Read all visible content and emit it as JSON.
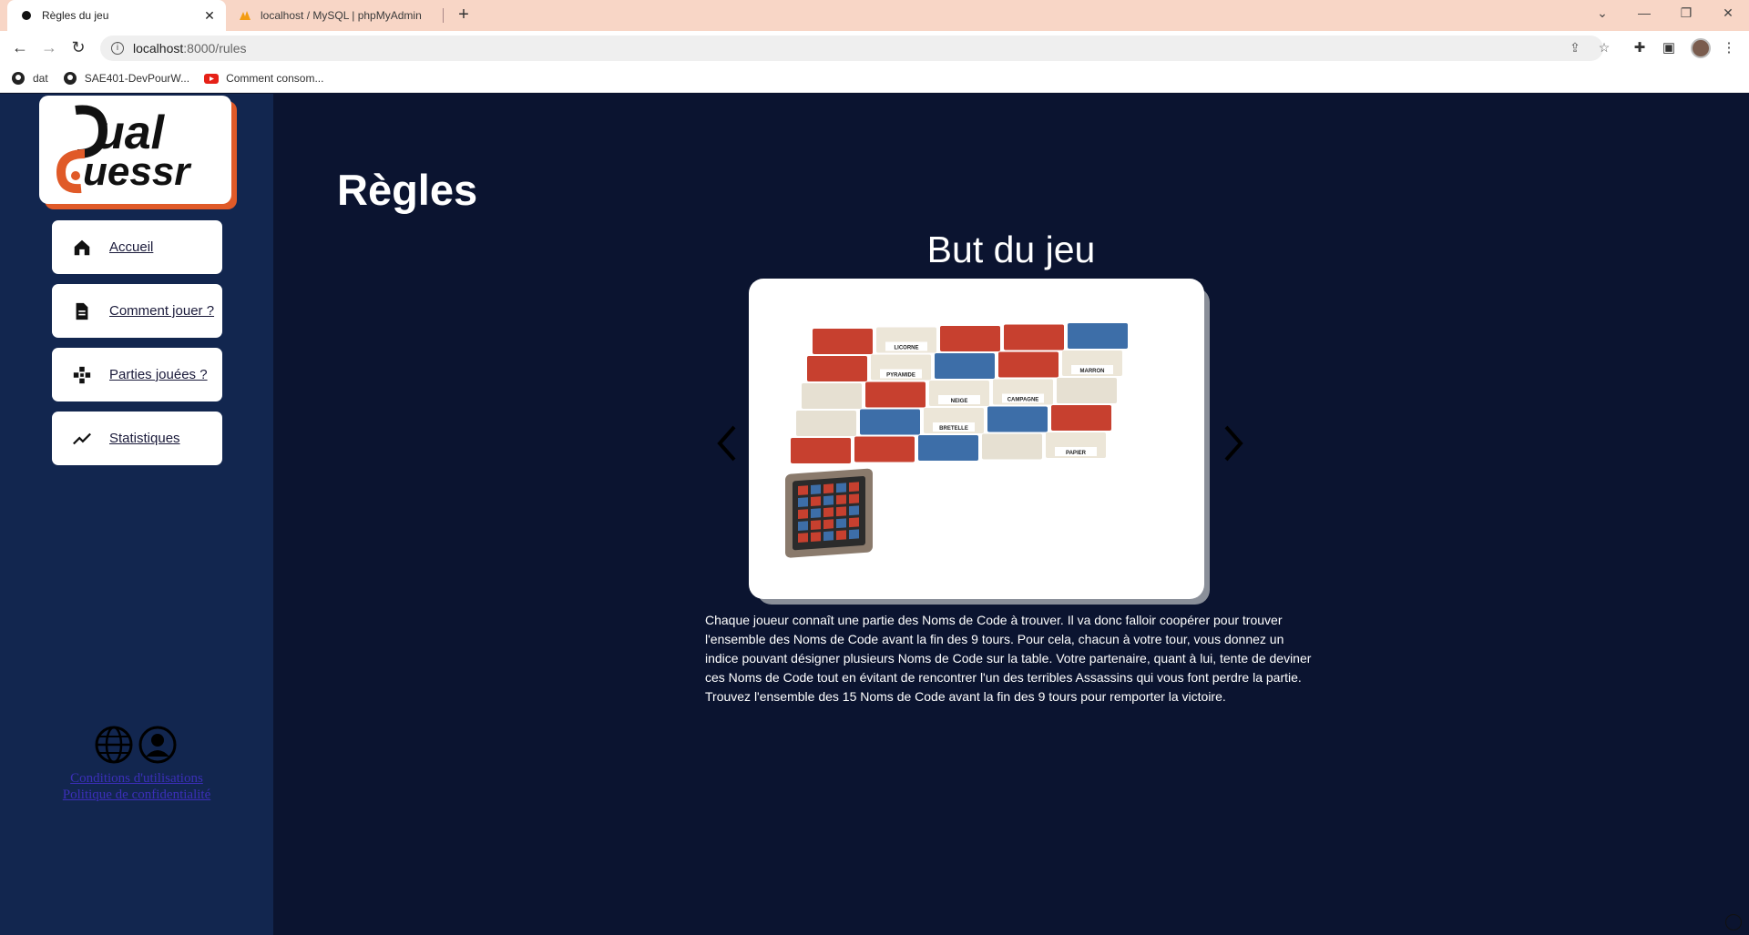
{
  "browser": {
    "tabs": [
      {
        "title": "Règles du jeu",
        "close": "✕"
      },
      {
        "title": "localhost / MySQL | phpMyAdmin"
      }
    ],
    "new_tab": "+",
    "url_host": "localhost",
    "url_path": ":8000/rules",
    "bookmarks": [
      {
        "label": "dat"
      },
      {
        "label": "SAE401-DevPourW..."
      },
      {
        "label": "Comment consom..."
      }
    ]
  },
  "sidebar": {
    "logo_alt": "Dual Guessr",
    "nav": [
      {
        "label": "Accueil",
        "icon": "home-icon"
      },
      {
        "label": "Comment jouer ?",
        "icon": "document-icon"
      },
      {
        "label": "Parties jouées ?",
        "icon": "gamepad-icon"
      },
      {
        "label": "Statistiques",
        "icon": "chart-line-icon"
      }
    ],
    "footer_links": {
      "terms": "Conditions d'utilisations",
      "privacy": "Politique de confidentialité"
    }
  },
  "main": {
    "title": "Règles",
    "section_title": "But du jeu",
    "description": "Chaque joueur connaît une partie des Noms de Code à trouver. Il va donc falloir coopérer pour trouver l'ensemble des Noms de Code avant la fin des 9 tours. Pour cela, chacun à votre tour, vous donnez un indice pouvant désigner plusieurs Noms de Code sur la table. Votre partenaire, quant à lui, tente de deviner ces Noms de Code tout en évitant de rencontrer l'un des terribles Assassins qui vous font perdre la partie. Trouvez l'ensemble des 15 Noms de Code avant la fin des 9 tours pour remporter la victoire.",
    "card_words": [
      "LICORNE",
      "PYRAMIDE",
      "MARRON",
      "NEIGE",
      "CAMPAGNE",
      "BRETELLE",
      "PAPIER"
    ]
  },
  "colors": {
    "page_bg": "#0b1430",
    "sidebar_bg": "#12264f",
    "accent": "#e05a28"
  }
}
